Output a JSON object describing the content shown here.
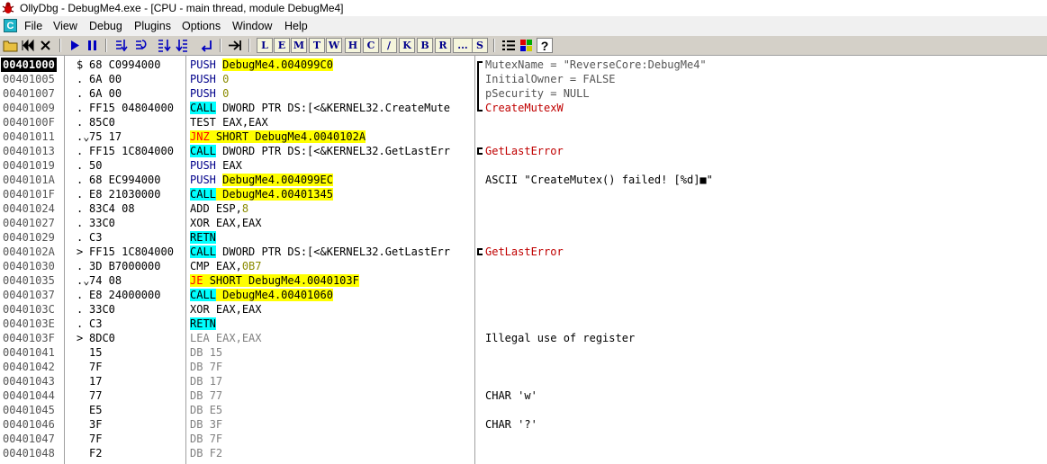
{
  "window": {
    "title": "OllyDbg - DebugMe4.exe - [CPU - main thread, module DebugMe4]"
  },
  "menu": {
    "icon_letter": "C",
    "items": [
      "File",
      "View",
      "Debug",
      "Plugins",
      "Options",
      "Window",
      "Help"
    ]
  },
  "toolbar": {
    "letters": [
      "L",
      "E",
      "M",
      "T",
      "W",
      "H",
      "C",
      "/",
      "K",
      "B",
      "R",
      "...",
      "S"
    ]
  },
  "colors": {
    "highlight_yellow": "#ffff00",
    "highlight_cyan": "#00ffff",
    "jump_red": "#ff0000",
    "api_darkred": "#c00000",
    "selected_bg": "#000000",
    "toolbar_bg": "#d4d0c8"
  },
  "disasm": {
    "rows": [
      {
        "addr": "00401000",
        "mark": "$",
        "hex": "68 C0994000",
        "op": "PUSH",
        "arg": "DebugMe4.004099C0",
        "cmt": "MutexName = \"ReverseCore:DebugMe4\""
      },
      {
        "addr": "00401005",
        "mark": ".",
        "hex": "6A 00",
        "op": "PUSH",
        "arg": "0",
        "cmt": "InitialOwner = FALSE"
      },
      {
        "addr": "00401007",
        "mark": ".",
        "hex": "6A 00",
        "op": "PUSH",
        "arg": "0",
        "cmt": "pSecurity = NULL"
      },
      {
        "addr": "00401009",
        "mark": ".",
        "hex": "FF15 04804000",
        "op": "CALL",
        "arg": "DWORD PTR DS:[<&KERNEL32.CreateMute",
        "cmt": "CreateMutexW"
      },
      {
        "addr": "0040100F",
        "mark": ".",
        "hex": "85C0",
        "op": "TEST",
        "arg": "EAX,EAX",
        "cmt": ""
      },
      {
        "addr": "00401011",
        "mark": ".⌄",
        "hex": "75 17",
        "op": "JNZ",
        "arg": "SHORT DebugMe4.0040102A",
        "cmt": ""
      },
      {
        "addr": "00401013",
        "mark": ".",
        "hex": "FF15 1C804000",
        "op": "CALL",
        "arg": "DWORD PTR DS:[<&KERNEL32.GetLastErr",
        "cmt": "GetLastError"
      },
      {
        "addr": "00401019",
        "mark": ".",
        "hex": "50",
        "op": "PUSH",
        "arg": "EAX",
        "cmt": ""
      },
      {
        "addr": "0040101A",
        "mark": ".",
        "hex": "68 EC994000",
        "op": "PUSH",
        "arg": "DebugMe4.004099EC",
        "cmt": "ASCII \"CreateMutex() failed! [%d]■\""
      },
      {
        "addr": "0040101F",
        "mark": ".",
        "hex": "E8 21030000",
        "op": "CALL",
        "arg": "DebugMe4.00401345",
        "cmt": ""
      },
      {
        "addr": "00401024",
        "mark": ".",
        "hex": "83C4 08",
        "op": "ADD",
        "arg": "ESP,8",
        "cmt": ""
      },
      {
        "addr": "00401027",
        "mark": ".",
        "hex": "33C0",
        "op": "XOR",
        "arg": "EAX,EAX",
        "cmt": ""
      },
      {
        "addr": "00401029",
        "mark": ".",
        "hex": "C3",
        "op": "RETN",
        "arg": "",
        "cmt": ""
      },
      {
        "addr": "0040102A",
        "mark": ">",
        "hex": "FF15 1C804000",
        "op": "CALL",
        "arg": "DWORD PTR DS:[<&KERNEL32.GetLastErr",
        "cmt": "GetLastError"
      },
      {
        "addr": "00401030",
        "mark": ".",
        "hex": "3D B7000000",
        "op": "CMP",
        "arg": "EAX,0B7",
        "cmt": ""
      },
      {
        "addr": "00401035",
        "mark": ".⌄",
        "hex": "74 08",
        "op": "JE",
        "arg": "SHORT DebugMe4.0040103F",
        "cmt": ""
      },
      {
        "addr": "00401037",
        "mark": ".",
        "hex": "E8 24000000",
        "op": "CALL",
        "arg": "DebugMe4.00401060",
        "cmt": ""
      },
      {
        "addr": "0040103C",
        "mark": ".",
        "hex": "33C0",
        "op": "XOR",
        "arg": "EAX,EAX",
        "cmt": ""
      },
      {
        "addr": "0040103E",
        "mark": ".",
        "hex": "C3",
        "op": "RETN",
        "arg": "",
        "cmt": ""
      },
      {
        "addr": "0040103F",
        "mark": ">",
        "hex": "8DC0",
        "op": "LEA",
        "arg": "EAX,EAX",
        "cmt": "Illegal use of register"
      },
      {
        "addr": "00401041",
        "mark": "",
        "hex": "15",
        "op": "DB",
        "arg": "15",
        "cmt": ""
      },
      {
        "addr": "00401042",
        "mark": "",
        "hex": "7F",
        "op": "DB",
        "arg": "7F",
        "cmt": ""
      },
      {
        "addr": "00401043",
        "mark": "",
        "hex": "17",
        "op": "DB",
        "arg": "17",
        "cmt": ""
      },
      {
        "addr": "00401044",
        "mark": "",
        "hex": "77",
        "op": "DB",
        "arg": "77",
        "cmt": "CHAR 'w'"
      },
      {
        "addr": "00401045",
        "mark": "",
        "hex": "E5",
        "op": "DB",
        "arg": "E5",
        "cmt": ""
      },
      {
        "addr": "00401046",
        "mark": "",
        "hex": "3F",
        "op": "DB",
        "arg": "3F",
        "cmt": "CHAR '?'"
      },
      {
        "addr": "00401047",
        "mark": "",
        "hex": "7F",
        "op": "DB",
        "arg": "7F",
        "cmt": ""
      },
      {
        "addr": "00401048",
        "mark": "",
        "hex": "F2",
        "op": "DB",
        "arg": "F2",
        "cmt": ""
      }
    ]
  }
}
